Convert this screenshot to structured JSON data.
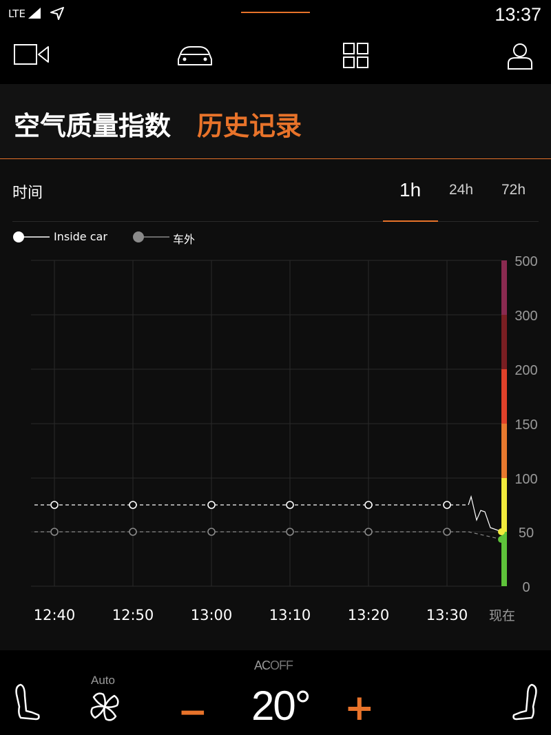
{
  "status_bar": {
    "network": "LTE",
    "time": "13:37"
  },
  "header": {
    "tab_aqi": "空气质量指数",
    "tab_history": "历史记录"
  },
  "time_row": {
    "label": "时间",
    "ranges": [
      "1h",
      "24h",
      "72h"
    ],
    "selected": "1h"
  },
  "legend": {
    "inside": "Inside car",
    "outside": "车外"
  },
  "colors": {
    "accent": "#e8732a",
    "inside_line": "#ffffff",
    "outside_line": "#8a8a8a"
  },
  "chart_data": {
    "type": "line",
    "x": [
      "12:40",
      "12:50",
      "13:00",
      "13:10",
      "13:20",
      "13:30",
      "现在"
    ],
    "series": [
      {
        "name": "Inside car",
        "values": [
          75,
          75,
          75,
          75,
          75,
          75,
          50
        ]
      },
      {
        "name": "车外",
        "values": [
          50,
          50,
          50,
          50,
          50,
          50,
          43
        ]
      }
    ],
    "y_ticks": [
      "500",
      "300",
      "200",
      "150",
      "100",
      "50",
      "0"
    ],
    "scale_bands": [
      {
        "from": "0",
        "to": "50",
        "color": "#5ec33a"
      },
      {
        "from": "50",
        "to": "100",
        "color": "#f2ea3c"
      },
      {
        "from": "100",
        "to": "150",
        "color": "#e8792e"
      },
      {
        "from": "150",
        "to": "200",
        "color": "#e0412a"
      },
      {
        "from": "200",
        "to": "300",
        "color": "#7a1e22"
      },
      {
        "from": "300",
        "to": "500",
        "color": "#8a2a50"
      }
    ],
    "grid": true
  },
  "bottom_bar": {
    "ac_label": "AC",
    "ac_state": "OFF",
    "fan_mode": "Auto",
    "minus": "−",
    "temperature": "20°",
    "plus": "+"
  }
}
